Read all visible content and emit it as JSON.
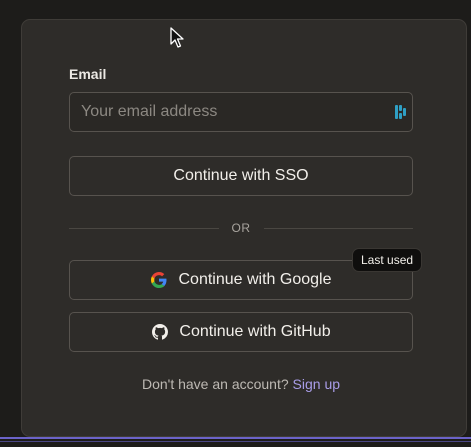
{
  "form": {
    "email_label": "Email",
    "email_placeholder": "Your email address",
    "email_value": ""
  },
  "buttons": {
    "sso_label": "Continue with SSO",
    "google_label": "Continue with Google",
    "github_label": "Continue with GitHub"
  },
  "divider": {
    "text": "OR"
  },
  "badge": {
    "text": "Last used"
  },
  "footer": {
    "prompt": "Don't have an account?",
    "link": "Sign up"
  },
  "colors": {
    "background": "#1d1c1a",
    "card": "#2e2c29",
    "accent_link": "#a99de8",
    "border": "#57534e"
  },
  "icons": {
    "password_manager": "password-manager-icon",
    "google": "google-icon",
    "github": "github-icon",
    "cursor": "mouse-cursor-icon"
  }
}
